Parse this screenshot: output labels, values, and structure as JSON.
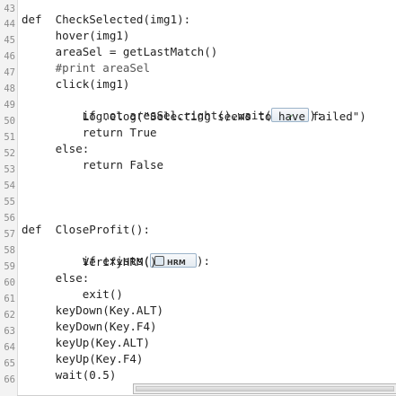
{
  "editor": {
    "line_numbers": [
      "43",
      "44",
      "45",
      "46",
      "47",
      "48",
      "49",
      "50",
      "51",
      "52",
      "53",
      "54",
      "55",
      "56",
      "57",
      "58",
      "59",
      "60",
      "61",
      "62",
      "63",
      "64",
      "65",
      "66"
    ],
    "lines": {
      "l44": "def  CheckSelected(img1):",
      "l45": "     hover(img1)",
      "l46": "     areaSel = getLastMatch()",
      "l47": "     #print areaSel",
      "l48": "     click(img1)",
      "l49a": "     if not areaSel.right().wait(",
      "l49b": "):",
      "l50": "         Log.elog(\"Selecting seems to have failed\")",
      "l51": "         return True",
      "l52": "     else:",
      "l53": "         return False",
      "l57": "def  CloseProfit():",
      "l58a": "     if exists(",
      "l58b": "):",
      "l59": "         VerifyHRM()",
      "l60": "     else:",
      "l61": "         exit()",
      "l62": "     keyDown(Key.ALT)",
      "l63": "     keyDown(Key.F4)",
      "l64": "     keyUp(Key.ALT)",
      "l65": "     keyUp(Key.F4)",
      "l66": "     wait(0.5)"
    },
    "screenshots": {
      "wait_image_label": "✓",
      "exists_image_label": "HRM"
    },
    "colors": {
      "gutter_bg": "#f3f3f3",
      "line_number": "#8a8a8a",
      "text": "#222222"
    }
  }
}
